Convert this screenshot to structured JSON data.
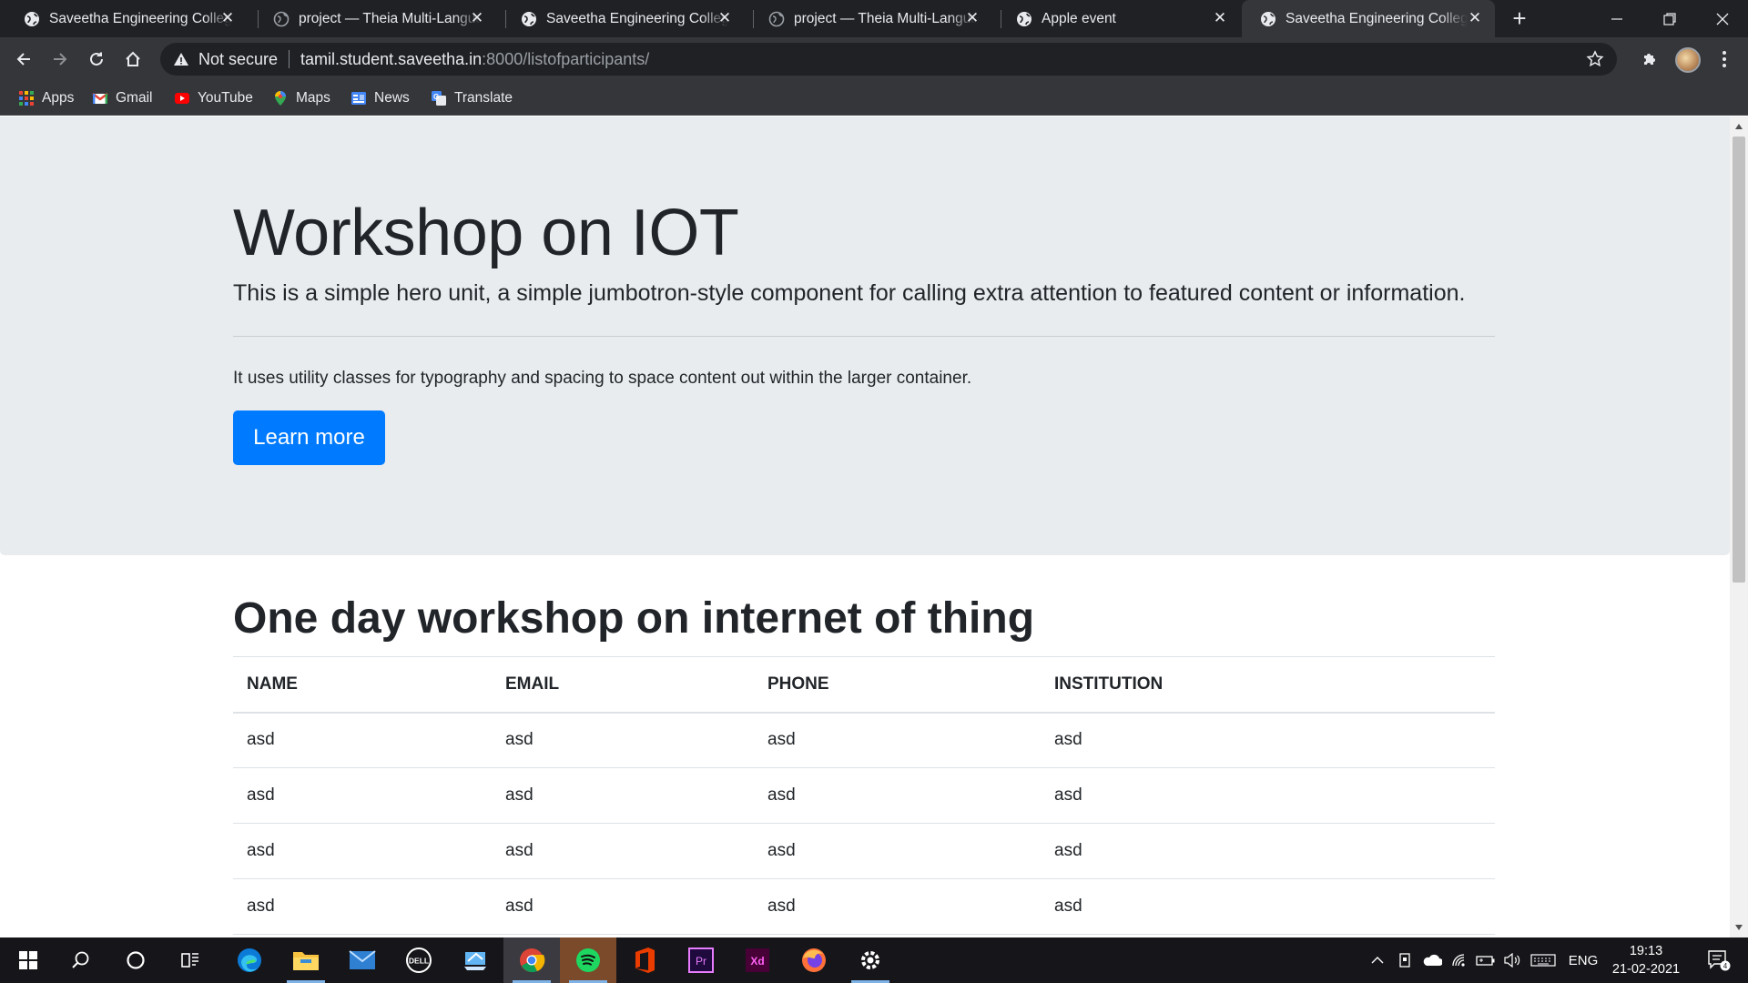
{
  "browser": {
    "tabs": [
      {
        "title": "Saveetha Engineering College"
      },
      {
        "title": "project — Theia Multi-Language"
      },
      {
        "title": "Saveetha Engineering College"
      },
      {
        "title": "project — Theia Multi-Language"
      },
      {
        "title": "Apple event"
      },
      {
        "title": "Saveetha Engineering College",
        "active": true
      }
    ],
    "address": {
      "security_label": "Not secure",
      "host": "tamil.student.saveetha.in",
      "path": ":8000/listofparticipants/"
    },
    "bookmarks": [
      "Apps",
      "Gmail",
      "YouTube",
      "Maps",
      "News",
      "Translate"
    ]
  },
  "page": {
    "jumbotron": {
      "title": "Workshop on IOT",
      "lead": "This is a simple hero unit, a simple jumbotron-style component for calling extra attention to featured content or information.",
      "body": "It uses utility classes for typography and spacing to space content out within the larger container.",
      "button_label": "Learn more"
    },
    "section_title": "One day workshop on internet of thing",
    "table": {
      "headers": [
        "NAME",
        "EMAIL",
        "PHONE",
        "INSTITUTION"
      ],
      "rows": [
        [
          "asd",
          "asd",
          "asd",
          "asd"
        ],
        [
          "asd",
          "asd",
          "asd",
          "asd"
        ],
        [
          "asd",
          "asd",
          "asd",
          "asd"
        ],
        [
          "asd",
          "asd",
          "asd",
          "asd"
        ]
      ]
    }
  },
  "taskbar": {
    "apps": [
      "start",
      "search",
      "cortana",
      "task-view",
      "edge",
      "file-explorer",
      "mail",
      "dell",
      "remote-desktop",
      "chrome",
      "spotify",
      "office",
      "premiere-pro",
      "adobe-xd",
      "firefox",
      "settings"
    ],
    "tray": {
      "language": "ENG",
      "time": "19:13",
      "date": "21-02-2021",
      "notification_count": "4"
    }
  },
  "colors": {
    "accent": "#007bff",
    "jumbotron_bg": "#e9ecef",
    "chrome_dark": "#202124",
    "toolbar": "#35363a"
  }
}
